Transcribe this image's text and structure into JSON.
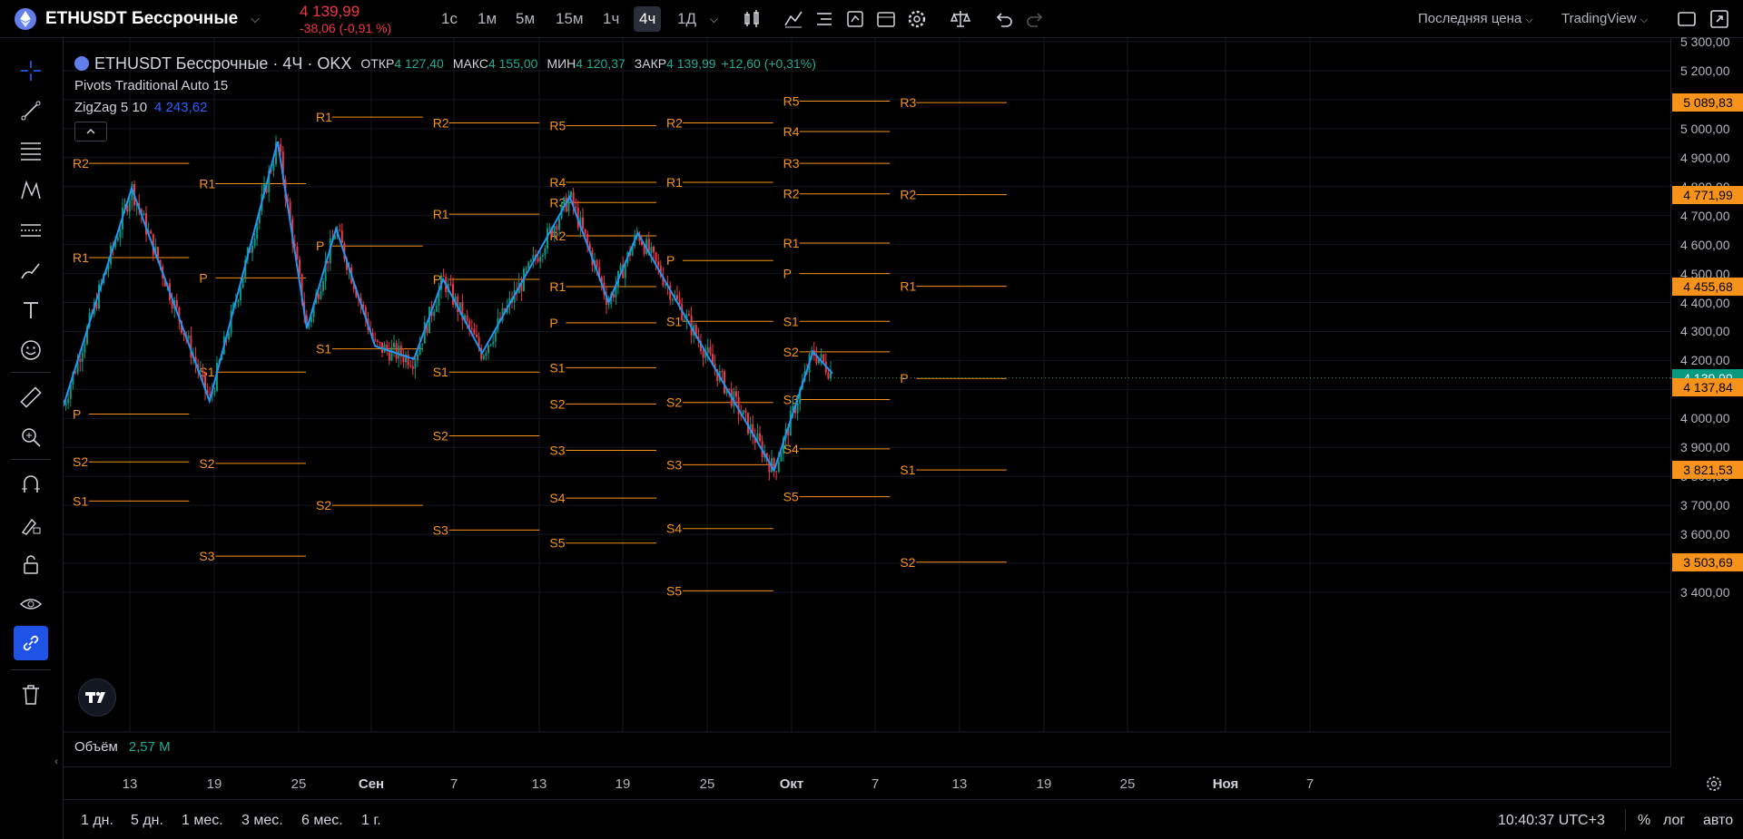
{
  "header": {
    "symbol": "ETHUSDT Бессрочные",
    "last_price": "4 139,99",
    "change": "-38,06 (-0,91 %)",
    "timeframes": [
      {
        "label": "1с",
        "active": false
      },
      {
        "label": "1м",
        "active": false
      },
      {
        "label": "5м",
        "active": false
      },
      {
        "label": "15м",
        "active": false
      },
      {
        "label": "1ч",
        "active": false
      },
      {
        "label": "4ч",
        "active": true
      },
      {
        "label": "1Д",
        "active": false
      }
    ],
    "price_source": "Последняя цена",
    "provider": "TradingView"
  },
  "legend": {
    "title": "ETHUSDT Бессрочные · 4Ч · OKX",
    "open_label": "ОТКР",
    "open": "4 127,40",
    "high_label": "МАКС",
    "high": "4 155,00",
    "low_label": "МИН",
    "low": "4 120,37",
    "close_label": "ЗАКР",
    "close": "4 139,99",
    "change": "+12,60 (+0,31%)",
    "pivots": "Pivots Traditional Auto 15",
    "zigzag": "ZigZag 5 10",
    "zigzag_value": "4 243,62"
  },
  "left_tools": [
    "crosshair-icon",
    "trendline-icon",
    "fib-icon",
    "pattern-icon",
    "prediction-icon",
    "brush-icon",
    "text-icon",
    "emoji-icon",
    "ruler-icon",
    "zoom-icon",
    "magnet-icon",
    "draw-lock-icon",
    "lock-icon",
    "eye-icon",
    "link-icon",
    "trash-icon"
  ],
  "volume": {
    "label": "Объём",
    "value": "2,57 M"
  },
  "colors": {
    "pivot": "#f7931a",
    "zigzag": "#2196f3",
    "up": "#089981",
    "down": "#f23645"
  },
  "chart_data": {
    "type": "candlestick",
    "symbol": "ETHUSDT Бессрочные",
    "timeframe": "4Ч",
    "ylim": [
      3400,
      5300
    ],
    "y_ticks": [
      "5 300,00",
      "5 200,00",
      "5 100,00",
      "5 000,00",
      "4 900,00",
      "4 800,00",
      "4 700,00",
      "4 600,00",
      "4 500,00",
      "4 400,00",
      "4 300,00",
      "4 200,00",
      "4 100,00",
      "4 000,00",
      "3 900,00",
      "3 800,00",
      "3 700,00",
      "3 600,00",
      "3 500,00",
      "3 400,00"
    ],
    "y_tick_values": [
      5300,
      5200,
      5100,
      5000,
      4900,
      4800,
      4700,
      4600,
      4500,
      4400,
      4300,
      4200,
      4100,
      4000,
      3900,
      3800,
      3700,
      3600,
      3500,
      3400
    ],
    "x_labels": [
      {
        "text": "13",
        "bold": false
      },
      {
        "text": "19",
        "bold": false
      },
      {
        "text": "25",
        "bold": false
      },
      {
        "text": "Сен",
        "bold": true
      },
      {
        "text": "7",
        "bold": false
      },
      {
        "text": "13",
        "bold": false
      },
      {
        "text": "19",
        "bold": false
      },
      {
        "text": "25",
        "bold": false
      },
      {
        "text": "Окт",
        "bold": true
      },
      {
        "text": "7",
        "bold": false
      },
      {
        "text": "13",
        "bold": false
      },
      {
        "text": "19",
        "bold": false
      },
      {
        "text": "25",
        "bold": false
      },
      {
        "text": "Ноя",
        "bold": true
      },
      {
        "text": "7",
        "bold": false
      }
    ],
    "price_tags": [
      {
        "text": "5 089,83",
        "value": 5089.83,
        "green": false
      },
      {
        "text": "4 771,99",
        "value": 4771.99,
        "green": false
      },
      {
        "text": "4 455,68",
        "value": 4455.68,
        "green": false
      },
      {
        "text": "4 139,99",
        "value": 4139.99,
        "green": true
      },
      {
        "text": "4 137,84",
        "value": 4107,
        "green": false
      },
      {
        "text": "3 821,53",
        "value": 3821.53,
        "green": false
      },
      {
        "text": "3 503,69",
        "value": 3503.69,
        "green": false
      }
    ],
    "zigzag": [
      [
        0,
        4045
      ],
      [
        7,
        4795
      ],
      [
        15,
        4060
      ],
      [
        22,
        4955
      ],
      [
        25,
        4310
      ],
      [
        28,
        4655
      ],
      [
        32,
        4250
      ],
      [
        36,
        4205
      ],
      [
        39,
        4480
      ],
      [
        43,
        4225
      ],
      [
        52,
        4765
      ],
      [
        56,
        4400
      ],
      [
        59,
        4640
      ],
      [
        65,
        4285
      ],
      [
        73,
        3820
      ],
      [
        77,
        4230
      ],
      [
        79,
        4155
      ]
    ],
    "zigzag_x_unit": "index",
    "pivot_periods": [
      {
        "x0": 0,
        "x1": 13,
        "levels": [
          [
            "R2",
            4880
          ],
          [
            "R1",
            4555
          ],
          [
            "P",
            4015
          ],
          [
            "S1",
            3715
          ],
          [
            "S2",
            3850
          ]
        ]
      },
      {
        "x0": 13,
        "x1": 25,
        "levels": [
          [
            "R1",
            4810
          ],
          [
            "P",
            4485
          ],
          [
            "S1",
            4160
          ],
          [
            "S2",
            3845
          ],
          [
            "S3",
            3525
          ]
        ]
      },
      {
        "x0": 25,
        "x1": 37,
        "levels": [
          [
            "R1",
            5040
          ],
          [
            "P",
            4595
          ],
          [
            "S1",
            4240
          ],
          [
            "S2",
            3700
          ]
        ]
      },
      {
        "x0": 37,
        "x1": 49,
        "levels": [
          [
            "R2",
            5020
          ],
          [
            "R1",
            4705
          ],
          [
            "P",
            4480
          ],
          [
            "S1",
            4160
          ],
          [
            "S2",
            3940
          ],
          [
            "S3",
            3615
          ]
        ]
      },
      {
        "x0": 49,
        "x1": 61,
        "levels": [
          [
            "R5",
            5010
          ],
          [
            "R4",
            4815
          ],
          [
            "R3",
            4745
          ],
          [
            "R2",
            4630
          ],
          [
            "R1",
            4455
          ],
          [
            "P",
            4330
          ],
          [
            "S1",
            4175
          ],
          [
            "S2",
            4050
          ],
          [
            "S3",
            3890
          ],
          [
            "S4",
            3725
          ],
          [
            "S5",
            3570
          ]
        ]
      },
      {
        "x0": 61,
        "x1": 73,
        "levels": [
          [
            "R2",
            5020
          ],
          [
            "R1",
            4815
          ],
          [
            "P",
            4545
          ],
          [
            "S1",
            4335
          ],
          [
            "S2",
            4055
          ],
          [
            "S3",
            3840
          ],
          [
            "S4",
            3620
          ],
          [
            "S5",
            3405
          ]
        ]
      },
      {
        "x0": 73,
        "x1": 85,
        "levels": [
          [
            "R5",
            5095
          ],
          [
            "R4",
            4990
          ],
          [
            "R3",
            4880
          ],
          [
            "R2",
            4775
          ],
          [
            "R1",
            4605
          ],
          [
            "P",
            4500
          ],
          [
            "S1",
            4335
          ],
          [
            "S2",
            4230
          ],
          [
            "S3",
            4065
          ],
          [
            "S4",
            3895
          ],
          [
            "S5",
            3730
          ]
        ]
      },
      {
        "x0": 85,
        "x1": 97,
        "levels": [
          [
            "R3",
            5090
          ],
          [
            "R2",
            4772
          ],
          [
            "R1",
            4456
          ],
          [
            "P",
            4138
          ],
          [
            "S1",
            3822
          ],
          [
            "S2",
            3504
          ]
        ]
      }
    ],
    "grid": true
  },
  "bottom": {
    "ranges": [
      "1 дн.",
      "5 дн.",
      "1 мес.",
      "3 мес.",
      "6 мес.",
      "1 г."
    ],
    "clock": "10:40:37 UTC+3",
    "percent": "%",
    "log": "лог",
    "auto": "авто"
  }
}
